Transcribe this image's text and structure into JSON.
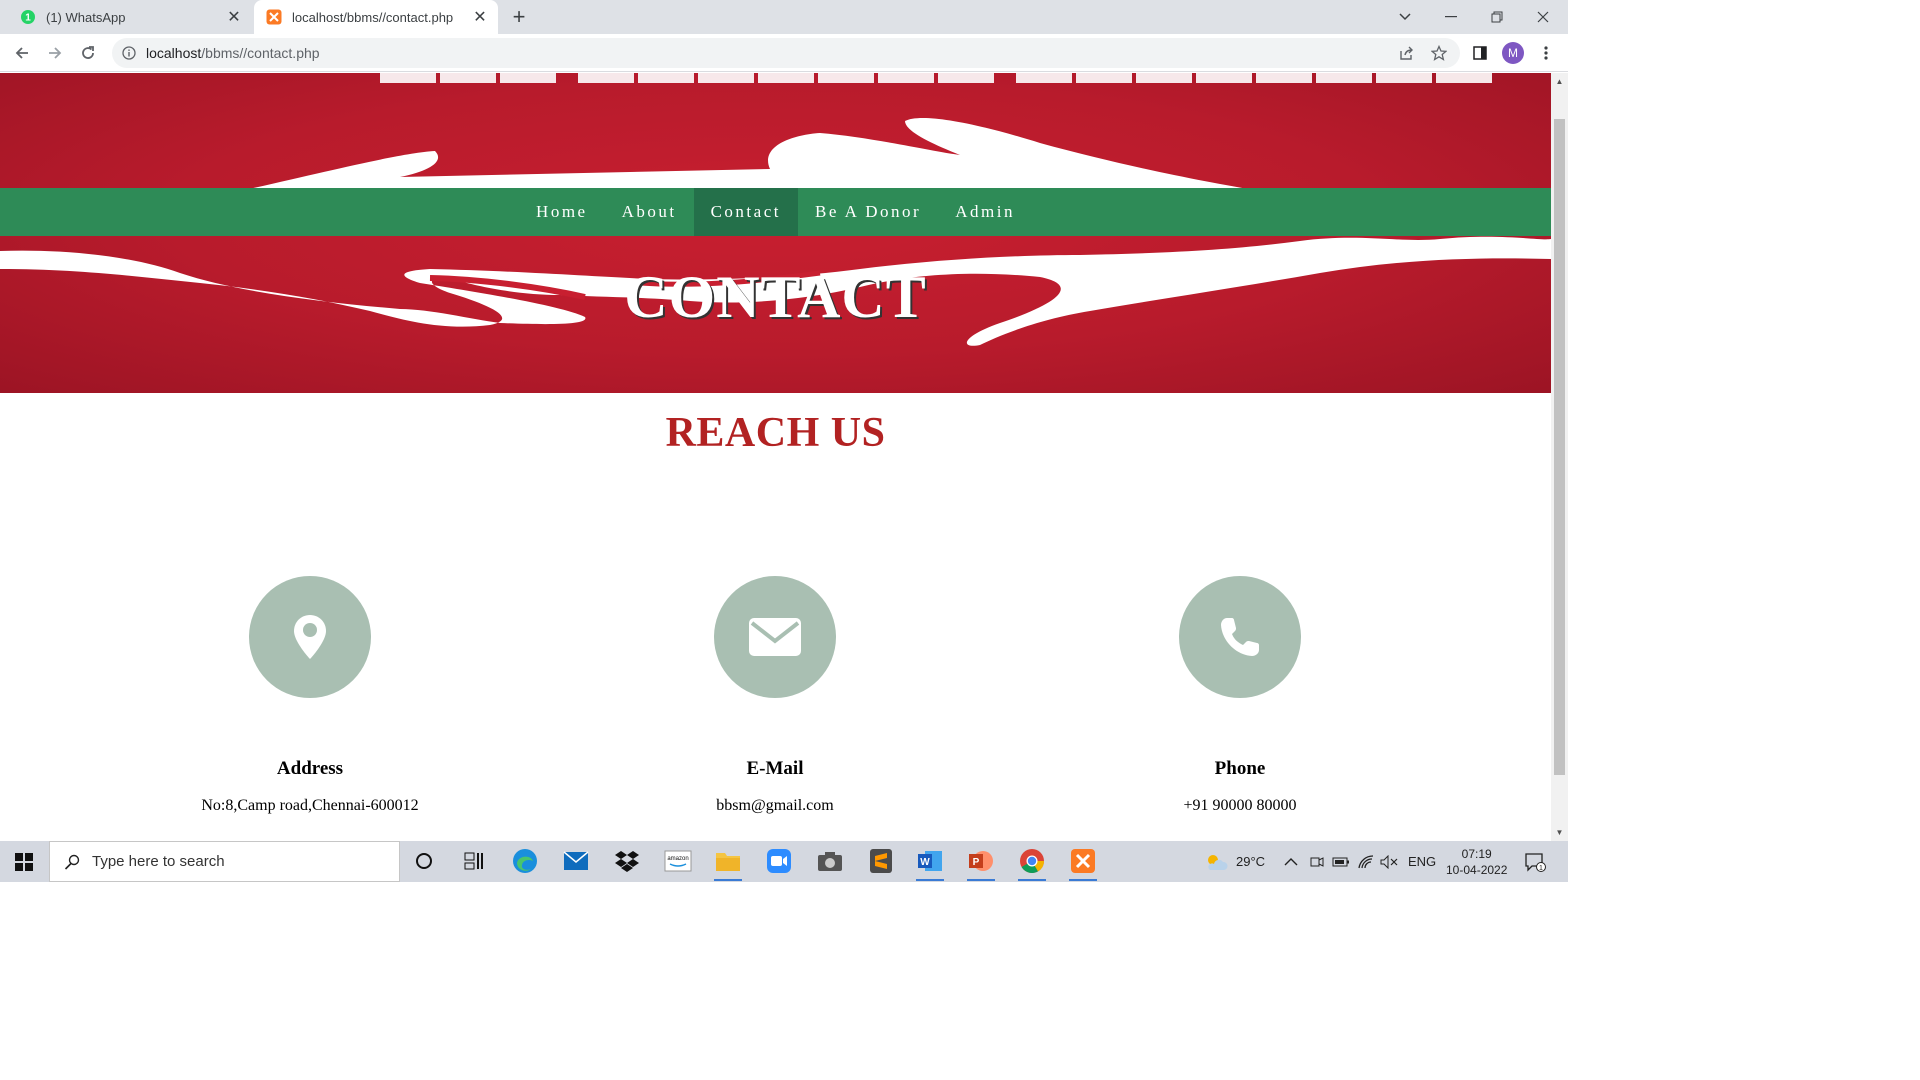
{
  "browser": {
    "tabs": [
      {
        "title": "(1) WhatsApp",
        "badge": "1",
        "active": false
      },
      {
        "title": "localhost/bbms//contact.php",
        "active": true
      }
    ],
    "url_host": "localhost",
    "url_path": "/bbms//contact.php",
    "profile_initial": "M"
  },
  "site": {
    "nav": [
      {
        "label": "Home"
      },
      {
        "label": "About"
      },
      {
        "label": "Contact",
        "active": true
      },
      {
        "label": "Be A Donor"
      },
      {
        "label": "Admin"
      }
    ],
    "hero_title": "CONTACT",
    "section_title": "REACH US",
    "cards": [
      {
        "icon": "map-pin-icon",
        "label": "Address",
        "value": "No:8,Camp road,Chennai-600012"
      },
      {
        "icon": "envelope-icon",
        "label": "E-Mail",
        "value": "bbsm@gmail.com"
      },
      {
        "icon": "phone-icon",
        "label": "Phone",
        "value": "+91 90000 80000"
      }
    ],
    "colors": {
      "hero_red": "#b81b2c",
      "nav_green": "#2e8b57",
      "nav_active": "#24704a",
      "heading_red": "#b22222",
      "icon_circle": "#a9bfb2"
    }
  },
  "taskbar": {
    "search_placeholder": "Type here to search",
    "weather": "29°C",
    "language": "ENG",
    "time": "07:19",
    "date": "10-04-2022",
    "notification_count": "1"
  }
}
